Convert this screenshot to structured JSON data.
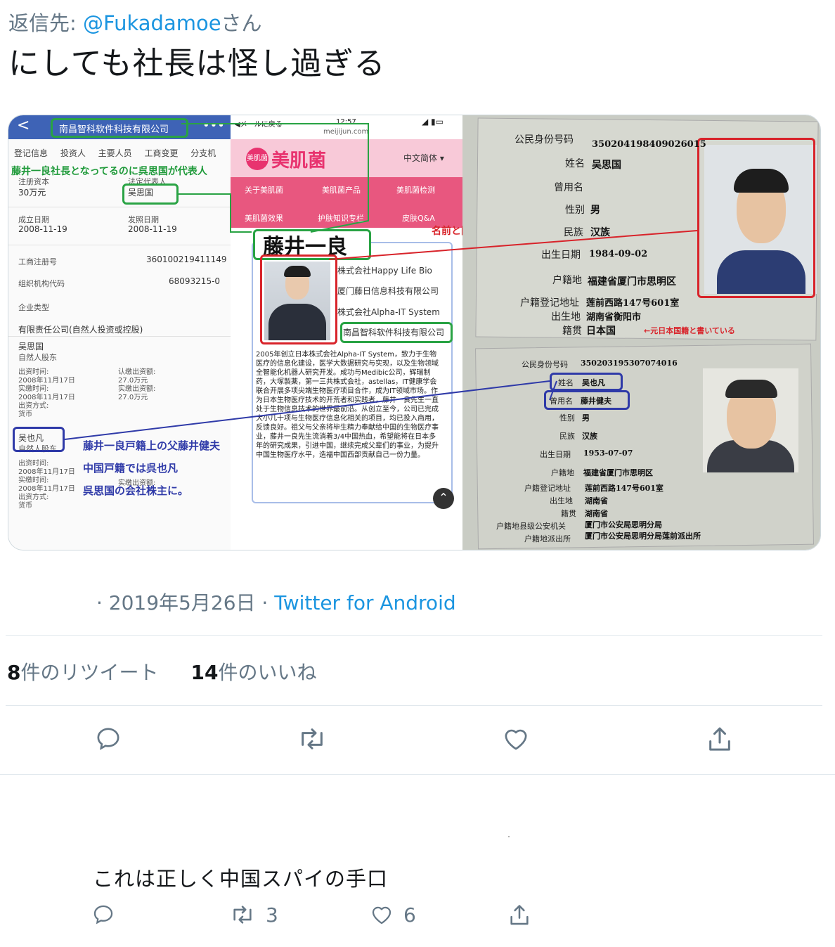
{
  "header": {
    "reply_prefix": "返信先: ",
    "reply_handle": "@Fukadamoe",
    "reply_suffix": "さん",
    "tweet_text": "にしても社長は怪し過ぎる"
  },
  "media": {
    "panel1": {
      "title": "南昌智科软件科技有限公司",
      "back": "<",
      "dots": "•••",
      "tabs": "登记信息 投资人 主要人员 工商变更 分支机",
      "annotation_top": "藤井一良社長となってるのに呉思国が代表人",
      "capital_label": "注册资本",
      "capital_value": "30万元",
      "rep_label": "法定代表人",
      "rep_value": "吴思国",
      "est_label": "成立日期",
      "est_value": "2008-11-19",
      "issue_label": "发照日期",
      "issue_value": "2008-11-19",
      "reg_no_label": "工商注册号",
      "reg_no_value": "360100219411149",
      "org_code_label": "组织机构代码",
      "org_code_value": "68093215-0",
      "type_label": "企业类型",
      "type_value": "有限责任公司(自然人投资或控股)",
      "holder1_name": "吴思国",
      "holder1_kind": "自然人股东",
      "holder1_detail": "出资时间:\n2008年11月17日\n实缴时间:\n2008年11月17日\n出资方式:\n货币",
      "holder1_amount": "认缴出资额:\n27.0万元\n实缴出资额:\n27.0万元",
      "holder2_name": "吴也凡",
      "holder2_kind": "自然人股东",
      "holder2_detail": "出资时间:\n2008年11月17日\n实缴时间:\n2008年11月17日\n出资方式:\n货币",
      "holder2_amount": "实缴出资额:",
      "annotation_bottom_1": "藤井一良戸籍上の父藤井健夫",
      "annotation_bottom_2": "中国戸籍では呉也凡",
      "annotation_bottom_3": "呉思国の会社株主に。"
    },
    "panel2": {
      "status_left": "◀メールに戻る",
      "status_time": "12:57",
      "status_url": "meijijun.com",
      "brand": "美肌菌",
      "logo_text": "美肌菌",
      "lang": "中文简体 ▾",
      "menu": [
        "关于美肌菌",
        "美肌菌产品",
        "美肌菌检测",
        "美肌菌效果",
        "护肤知识专栏",
        "皮肤Q&A"
      ],
      "name": "藤井一良",
      "companies": [
        "株式会社Happy Life Bio",
        "厦门藤日信息科技有限公司",
        "株式会社Alpha-IT System",
        "南昌智科软件科技有限公司"
      ],
      "bio": "2005年创立日本株式会社Alpha-IT System，致力于生物医疗的信息化建设，医学大数据研究与实现，以及生物领域全智能化机器人研究开发。成功与Medibic公司，辉瑞制药，大塚製薬，第一三共株式会社，astellas，IT健康学会联合开展多项尖端生物医疗项目合作，成为IT领域市场。作为日本生物医疗技术的开荒者和实践者，藤井一良先生一直处于生物信息技术的世界最前沿。从创立至今，公司已完成大小几十项与生物医疗信息化相关的项目，均已投入商用，反馈良好。祖父与父亲将毕生精力奉献给中国的生物医疗事业，藤井一良先生流淌着3/4中国热血，希望能将在日本多年的研究成果，引进中国，继续完成父辈们的事业，为提升中国生物医疗水平，造福中国西部贡献自己一份力量。",
      "annotation_right": "名前と国籍違うが顔同じ"
    },
    "panel3": {
      "a_labels": [
        "公民身份号码",
        "姓名",
        "曾用名",
        "性别",
        "民族",
        "出生日期",
        "户籍地",
        "户籍登记地址",
        "出生地",
        "籍贯"
      ],
      "a_values": [
        "350204198409026015",
        "吴思国",
        "",
        "男",
        "汉族",
        "1984-09-02",
        "福建省厦门市思明区",
        "莲前西路147号601室",
        "湖南省衡阳市",
        "日本国"
      ],
      "a_note": "←元日本国籍と書いている",
      "b_labels": [
        "公民身份号码",
        "姓名",
        "曾用名",
        "性别",
        "民族",
        "出生日期",
        "户籍地",
        "户籍登记地址",
        "出生地",
        "籍贯",
        "户籍地县级公安机关",
        "户籍地派出所"
      ],
      "b_values": [
        "350203195307074016",
        "吴也凡",
        "藤井健夫",
        "男",
        "汉族",
        "1953-07-07",
        "福建省厦门市思明区",
        "莲前西路147号601室",
        "湖南省",
        "湖南省",
        "厦门市公安局思明分局",
        "厦门市公安局思明分局莲前派出所"
      ]
    }
  },
  "meta": {
    "date": " · 2019年5月26日 · ",
    "source": "Twitter for Android"
  },
  "stats": {
    "retweet_count": "8",
    "retweet_label": "件のリツイート",
    "like_count": "14",
    "like_label": "件のいいね"
  },
  "reply": {
    "text": "これは正しく中国スパイの手口",
    "retweet_count": "3",
    "like_count": "6"
  },
  "colors": {
    "link": "#1b95e0",
    "muted": "#657786",
    "annotation_green": "#29a344",
    "annotation_red": "#d8232a",
    "annotation_blue": "#2f3aa8",
    "brand_pink": "#e8336f"
  },
  "icons": [
    "reply-icon",
    "retweet-icon",
    "like-icon",
    "share-icon"
  ]
}
